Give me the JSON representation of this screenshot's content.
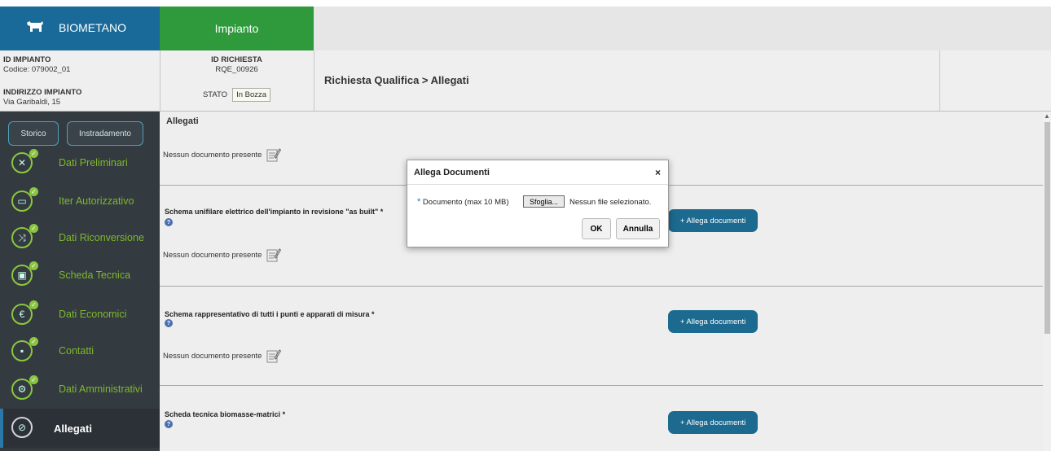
{
  "header": {
    "app_name": "BIOMETANO",
    "tab_label": "Impianto",
    "breadcrumb": "Richiesta Qualifica > Allegati"
  },
  "info": {
    "id_impianto_label": "ID IMPIANTO",
    "id_impianto_value": "Codice: 079002_01",
    "indirizzo_label": "INDIRIZZO IMPIANTO",
    "indirizzo_value": "Via Garibaldi, 15",
    "id_richiesta_label": "ID RICHIESTA",
    "id_richiesta_value": "RQE_00926",
    "stato_label": "STATO",
    "stato_value": "In Bozza"
  },
  "sidebar": {
    "buttons": [
      {
        "label": "Storico"
      },
      {
        "label": "Instradamento"
      }
    ],
    "items": [
      {
        "label": "Dati Preliminari",
        "icon": "tools-icon"
      },
      {
        "label": "Iter Autorizzativo",
        "icon": "battery-icon"
      },
      {
        "label": "Dati Riconversione",
        "icon": "shuffle-icon"
      },
      {
        "label": "Scheda Tecnica",
        "icon": "wallet-icon"
      },
      {
        "label": "Dati Economici",
        "icon": "euro-icon"
      },
      {
        "label": "Contatti",
        "icon": "contact-card-icon"
      },
      {
        "label": "Dati Amministrativi",
        "icon": "wrench-icon"
      },
      {
        "label": "Allegati",
        "icon": "paperclip-icon"
      }
    ]
  },
  "main": {
    "section_title": "Allegati",
    "no_document": "Nessun documento presente",
    "add_button": "+ Allega documenti",
    "requirements": [
      {
        "title": "Schema unifilare elettrico dell'impianto in revisione \"as built\" *"
      },
      {
        "title": "Schema rappresentativo di tutti i punti e apparati di misura *"
      },
      {
        "title": "Scheda tecnica biomasse-matrici *"
      }
    ],
    "help_glyph": "?"
  },
  "dialog": {
    "title": "Allega Documenti",
    "close": "×",
    "required_mark": "*",
    "field_label": "Documento (max 10 MB)",
    "browse_label": "Sfoglia...",
    "file_status": "Nessun file selezionato.",
    "ok_label": "OK",
    "cancel_label": "Annulla"
  },
  "colors": {
    "brand_blue": "#1a6a99",
    "tab_green": "#2f9a3c",
    "sidebar_bg": "#333a40",
    "nav_green": "#7fb82d",
    "button_blue": "#1c6a8f"
  }
}
